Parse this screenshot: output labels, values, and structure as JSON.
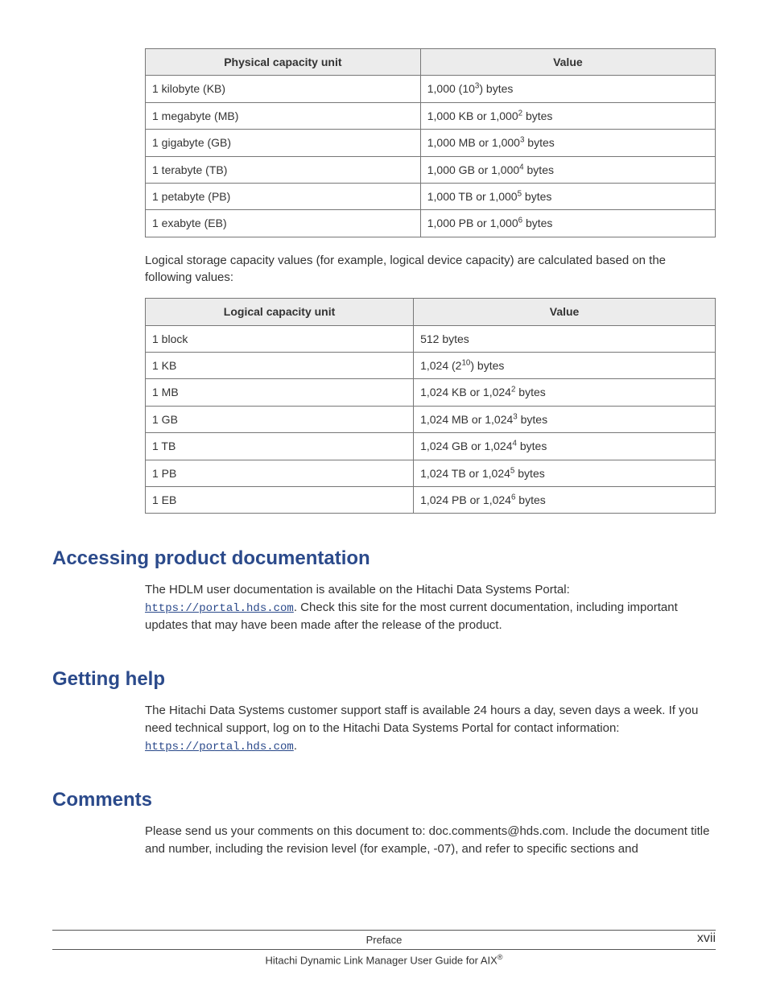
{
  "table1": {
    "headers": [
      "Physical capacity unit",
      "Value"
    ],
    "rows": [
      {
        "unit": "1 kilobyte (KB)",
        "value_pre": "1,000 (10",
        "sup": "3",
        "value_post": ") bytes"
      },
      {
        "unit": "1 megabyte (MB)",
        "value_pre": "1,000 KB or 1,000",
        "sup": "2",
        "value_post": " bytes"
      },
      {
        "unit": "1 gigabyte (GB)",
        "value_pre": "1,000 MB or 1,000",
        "sup": "3",
        "value_post": " bytes"
      },
      {
        "unit": "1 terabyte (TB)",
        "value_pre": "1,000 GB or 1,000",
        "sup": "4",
        "value_post": " bytes"
      },
      {
        "unit": "1 petabyte (PB)",
        "value_pre": "1,000 TB or 1,000",
        "sup": "5",
        "value_post": " bytes"
      },
      {
        "unit": "1 exabyte (EB)",
        "value_pre": "1,000 PB or 1,000",
        "sup": "6",
        "value_post": " bytes"
      }
    ]
  },
  "para1": "Logical storage capacity values (for example, logical device capacity) are calculated based on the following values:",
  "table2": {
    "headers": [
      "Logical capacity unit",
      "Value"
    ],
    "rows": [
      {
        "unit": "1 block",
        "value_pre": "512 bytes",
        "sup": "",
        "value_post": ""
      },
      {
        "unit": "1 KB",
        "value_pre": "1,024 (2",
        "sup": "10",
        "value_post": ") bytes"
      },
      {
        "unit": "1 MB",
        "value_pre": "1,024 KB or 1,024",
        "sup": "2",
        "value_post": " bytes"
      },
      {
        "unit": "1 GB",
        "value_pre": "1,024 MB or 1,024",
        "sup": "3",
        "value_post": " bytes"
      },
      {
        "unit": "1 TB",
        "value_pre": "1,024 GB or 1,024",
        "sup": "4",
        "value_post": " bytes"
      },
      {
        "unit": "1 PB",
        "value_pre": "1,024 TB or 1,024",
        "sup": "5",
        "value_post": " bytes"
      },
      {
        "unit": "1 EB",
        "value_pre": "1,024 PB or 1,024",
        "sup": "6",
        "value_post": " bytes"
      }
    ]
  },
  "sections": {
    "accessing": {
      "heading": "Accessing product documentation",
      "body_a": "The HDLM user documentation is available on the Hitachi Data Systems Portal: ",
      "link": "https://portal.hds.com",
      "body_b": ". Check this site for the most current documentation, including important updates that may have been made after the release of the product."
    },
    "help": {
      "heading": "Getting help",
      "body_a": "The Hitachi Data Systems customer support staff is available 24 hours a day, seven days a week. If you need technical support, log on to the Hitachi Data Systems Portal for contact information: ",
      "link": "https://portal.hds.com",
      "body_b": "."
    },
    "comments": {
      "heading": "Comments",
      "body": "Please send us your comments on this document to: doc.comments@hds.com. Include the document title and number, including the revision level (for example, -07), and refer to specific sections and"
    }
  },
  "footer": {
    "line1": "Preface",
    "line2_pre": "Hitachi Dynamic Link Manager User Guide for AIX",
    "reg": "®",
    "page": "xvii"
  }
}
